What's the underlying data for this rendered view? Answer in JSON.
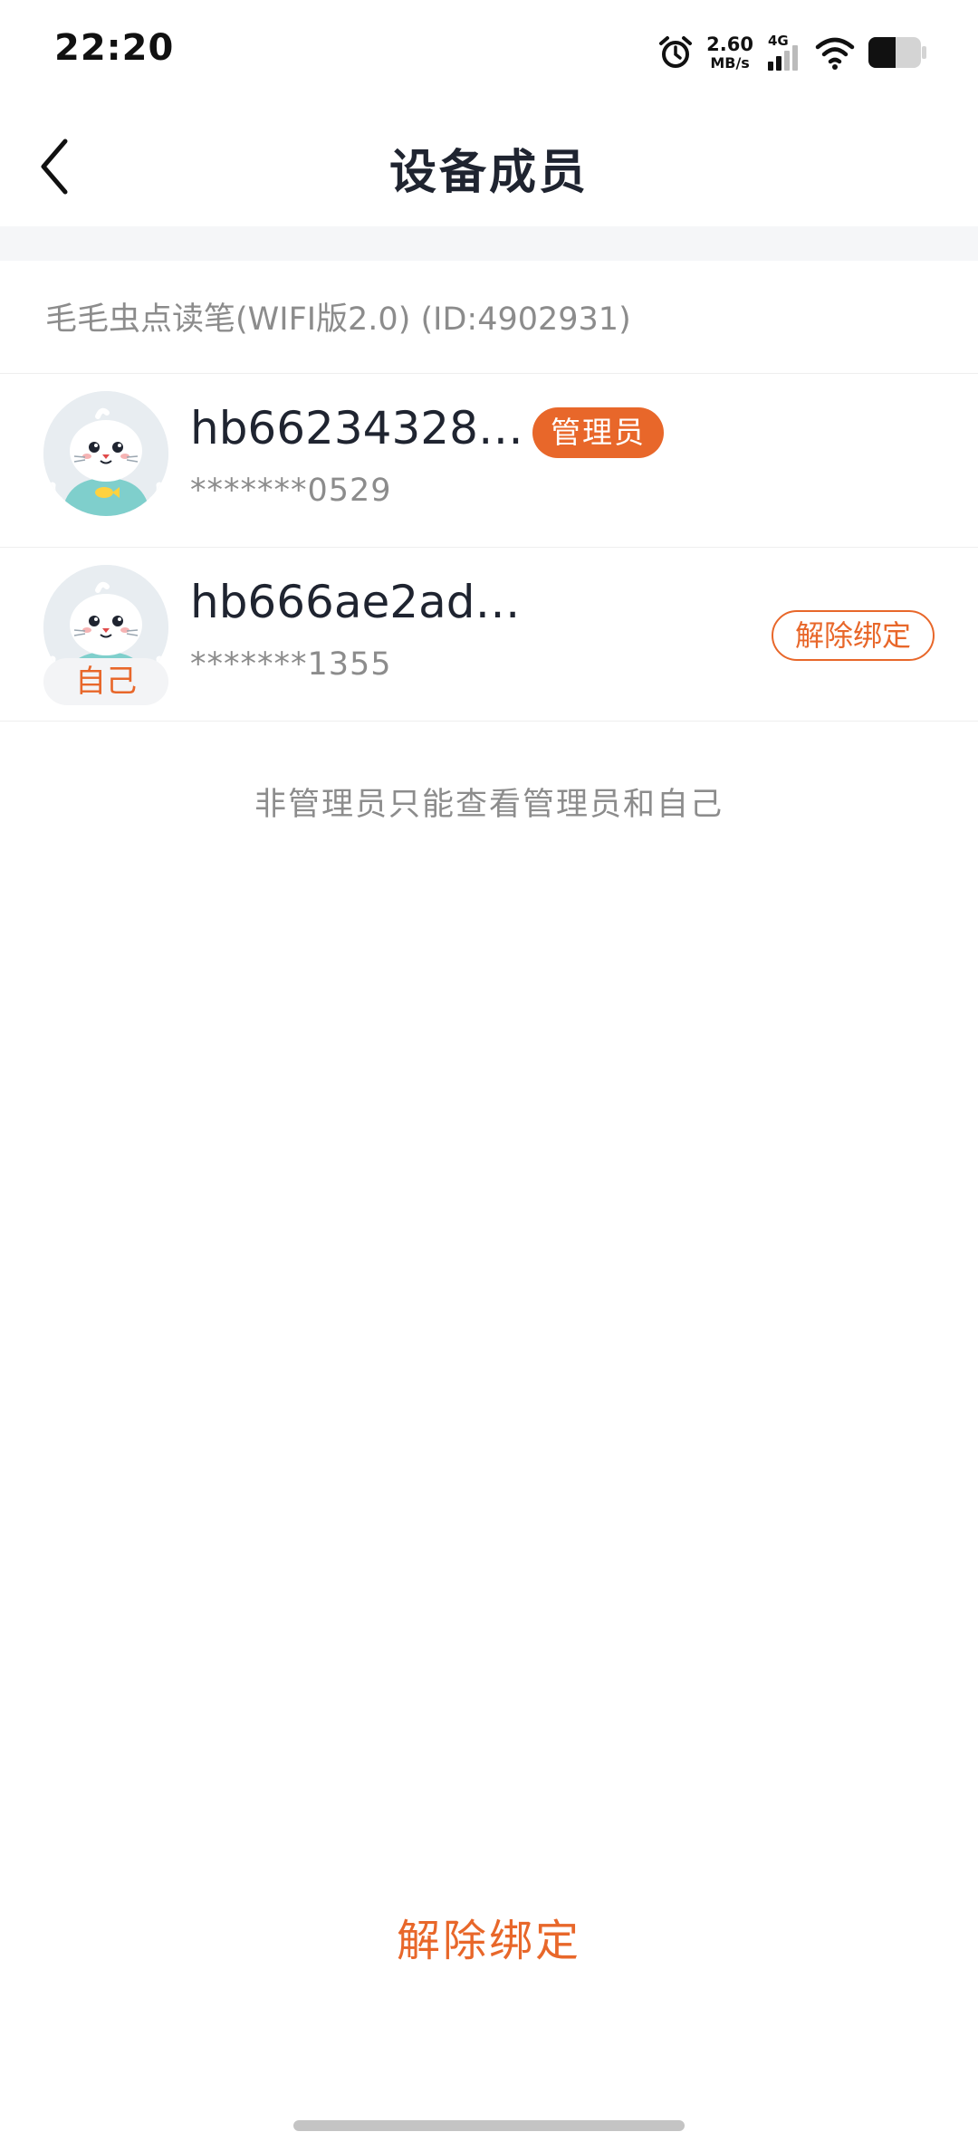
{
  "status_bar": {
    "time": "22:20",
    "net_speed_value": "2.60",
    "net_speed_unit": "MB/s",
    "network_type": "4G",
    "icons": [
      "alarm-icon",
      "signal-icon",
      "wifi-icon",
      "battery-icon"
    ]
  },
  "header": {
    "title": "设备成员",
    "back_icon": "chevron-left-icon"
  },
  "device": {
    "name": "毛毛虫点读笔(WIFI版2.0) (ID:4902931)"
  },
  "members": [
    {
      "name": "hb66234328…",
      "phone": "*******0529",
      "role_tag": "管理员"
    },
    {
      "name": "hb666ae2ad…",
      "phone": "*******1355",
      "self_badge": "自己",
      "unbind_label": "解除绑定"
    }
  ],
  "hint": "非管理员只能查看管理员和自己",
  "bottom_action": {
    "label": "解除绑定"
  },
  "colors": {
    "accent": "#e8672a",
    "title": "#1f2430",
    "muted": "#8c8c8c",
    "divider_bg": "#f5f6f8"
  }
}
